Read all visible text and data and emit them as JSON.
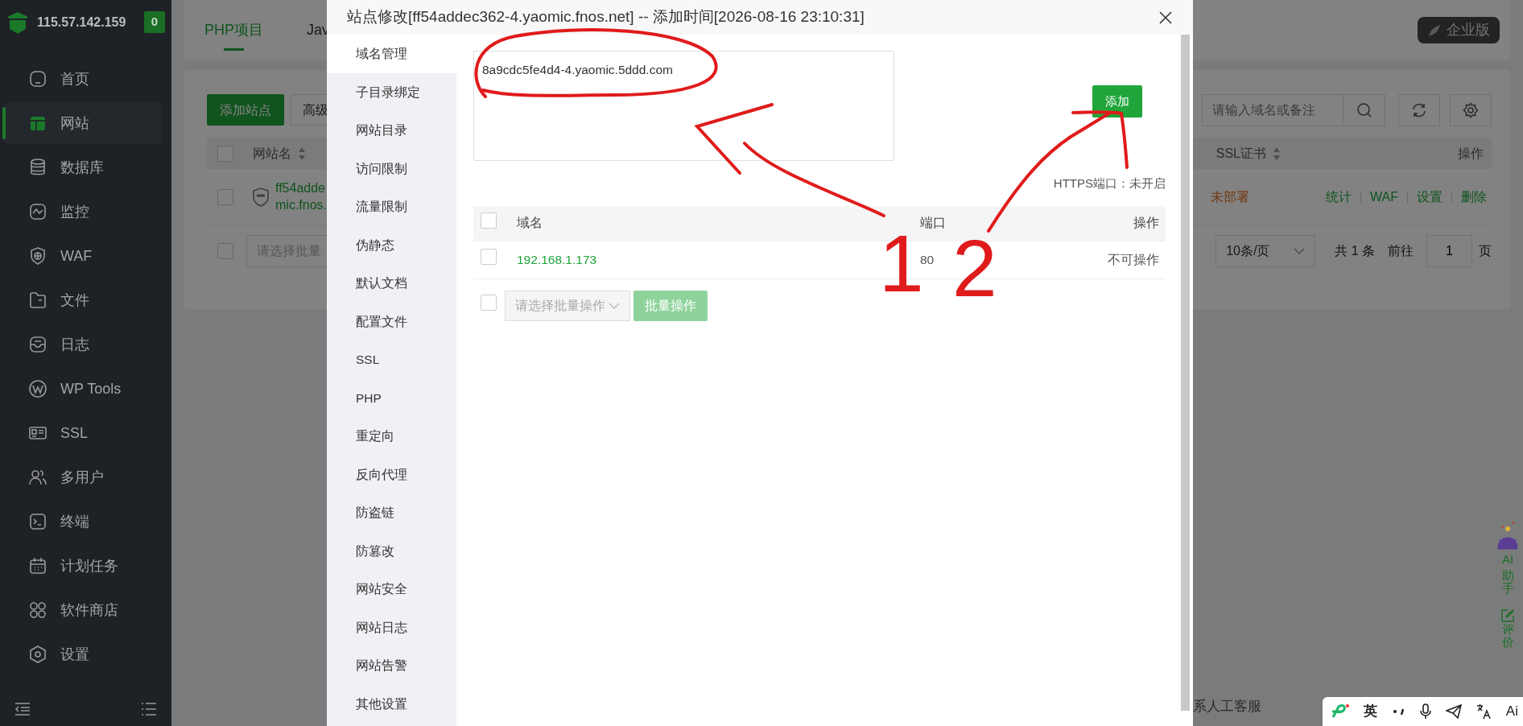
{
  "sidebar": {
    "server_ip": "115.57.142.159",
    "alert_count": "0",
    "items": [
      {
        "label": "首页",
        "selected": false
      },
      {
        "label": "网站",
        "selected": true
      },
      {
        "label": "数据库",
        "selected": false
      },
      {
        "label": "监控",
        "selected": false
      },
      {
        "label": "WAF",
        "selected": false
      },
      {
        "label": "文件",
        "selected": false
      },
      {
        "label": "日志",
        "selected": false
      },
      {
        "label": "WP Tools",
        "selected": false
      },
      {
        "label": "SSL",
        "selected": false
      },
      {
        "label": "多用户",
        "selected": false
      },
      {
        "label": "终端",
        "selected": false
      },
      {
        "label": "计划任务",
        "selected": false
      },
      {
        "label": "软件商店",
        "selected": false
      },
      {
        "label": "设置",
        "selected": false
      }
    ]
  },
  "background_page": {
    "tabs": [
      {
        "label": "PHP项目",
        "selected": true
      },
      {
        "label": "Jav",
        "selected": false
      }
    ],
    "edition_badge": "企业版",
    "add_site_button": "添加站点",
    "advanced_button": "高级",
    "search_placeholder": "请输入域名或备注",
    "table": {
      "select_all_checked": false,
      "columns": [
        "网站名",
        "SSL证书",
        "操作"
      ],
      "rows": [
        {
          "name_line_1": "ff54adde",
          "name_line_2": "mic.fnos.",
          "ssl": "未部署",
          "actions": [
            "统计",
            "WAF",
            "设置",
            "删除"
          ],
          "checked": false
        }
      ]
    },
    "batch_checked": false,
    "batch_placeholder": "请选择批量",
    "page_size": "10条/页",
    "total": "共 1 条",
    "goto": "前往",
    "page": "1",
    "page_suffix": "页",
    "support_text": "系人工客服"
  },
  "dialog": {
    "title": "站点修改[ff54addec362-4.yaomic.fnos.net] -- 添加时间[2026-08-16 23:10:31]",
    "nav": [
      {
        "label": "域名管理",
        "selected": true
      },
      {
        "label": "子目录绑定",
        "selected": false
      },
      {
        "label": "网站目录",
        "selected": false
      },
      {
        "label": "访问限制",
        "selected": false
      },
      {
        "label": "流量限制",
        "selected": false
      },
      {
        "label": "伪静态",
        "selected": false
      },
      {
        "label": "默认文档",
        "selected": false
      },
      {
        "label": "配置文件",
        "selected": false
      },
      {
        "label": "SSL",
        "selected": false
      },
      {
        "label": "PHP",
        "selected": false
      },
      {
        "label": "重定向",
        "selected": false
      },
      {
        "label": "反向代理",
        "selected": false
      },
      {
        "label": "防盗链",
        "selected": false
      },
      {
        "label": "防篡改",
        "selected": false
      },
      {
        "label": "网站安全",
        "selected": false
      },
      {
        "label": "网站日志",
        "selected": false
      },
      {
        "label": "网站告警",
        "selected": false
      },
      {
        "label": "其他设置",
        "selected": false
      }
    ],
    "domain_input": "8a9cdc5fe4d4-4.yaomic.5ddd.com",
    "add_button": "添加",
    "https_status": "HTTPS端口：未开启",
    "table": {
      "select_all_checked": false,
      "columns": [
        "域名",
        "端口",
        "操作"
      ],
      "rows": [
        {
          "domain": "192.168.1.173",
          "port": "80",
          "action": "不可操作",
          "checked": false
        }
      ]
    },
    "batch_checked": false,
    "batch_placeholder": "请选择批量操作",
    "batch_button": "批量操作"
  },
  "ai_panel": {
    "title_latin": "AI",
    "title": "助手",
    "review": "评价"
  },
  "ime_toolbar": {
    "mode": "英",
    "ai_label": "Ai"
  },
  "annotation_labels": [
    "1",
    "2"
  ]
}
